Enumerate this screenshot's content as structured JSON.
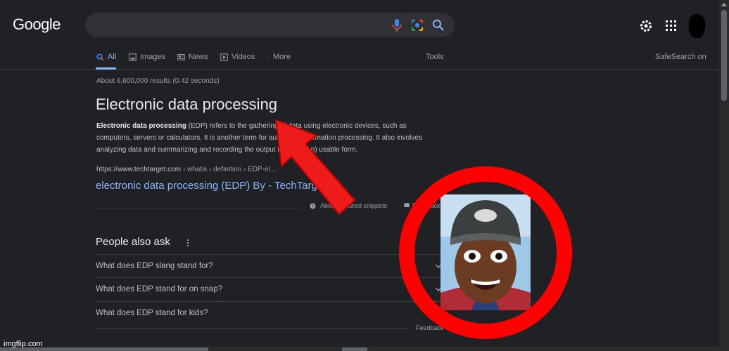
{
  "header": {
    "logo": "Google",
    "search_value": ""
  },
  "tabs": [
    {
      "label": "All",
      "icon": "search-icon"
    },
    {
      "label": "Images",
      "icon": "image-icon"
    },
    {
      "label": "News",
      "icon": "news-icon"
    },
    {
      "label": "Videos",
      "icon": "play-icon"
    },
    {
      "label": "More",
      "icon": "more-vert-icon"
    }
  ],
  "tools_label": "Tools",
  "safesearch_label": "SafeSearch on",
  "result_stats": "About 6,600,000 results (0.42 seconds)",
  "featured_snippet": {
    "title": "Electronic data processing",
    "bold_lead": "Electronic data processing",
    "text": " (EDP) refers to the gathering of data using electronic devices, such as computers, servers or calculators. It is another term for automatic information processing. It also involves analyzing data and summarizing and recording the output in a (human) usable form.",
    "source_domain": "https://www.techtarget.com",
    "source_path": " › whatis › definition › EDP-el...",
    "link_text": "electronic data processing (EDP) By - TechTarget",
    "about_label": "About featured snippets",
    "feedback_label": "Feedback"
  },
  "people_also_ask": {
    "title": "People also ask",
    "questions": [
      "What does EDP slang stand for?",
      "What does EDP stand for on snap?",
      "What does EDP stand for kids?"
    ],
    "feedback_label": "Feedback"
  },
  "watermark": "imgflip.com",
  "colors": {
    "background": "#202124",
    "link": "#8ab4f8",
    "overlay_red": "#ff0000"
  }
}
